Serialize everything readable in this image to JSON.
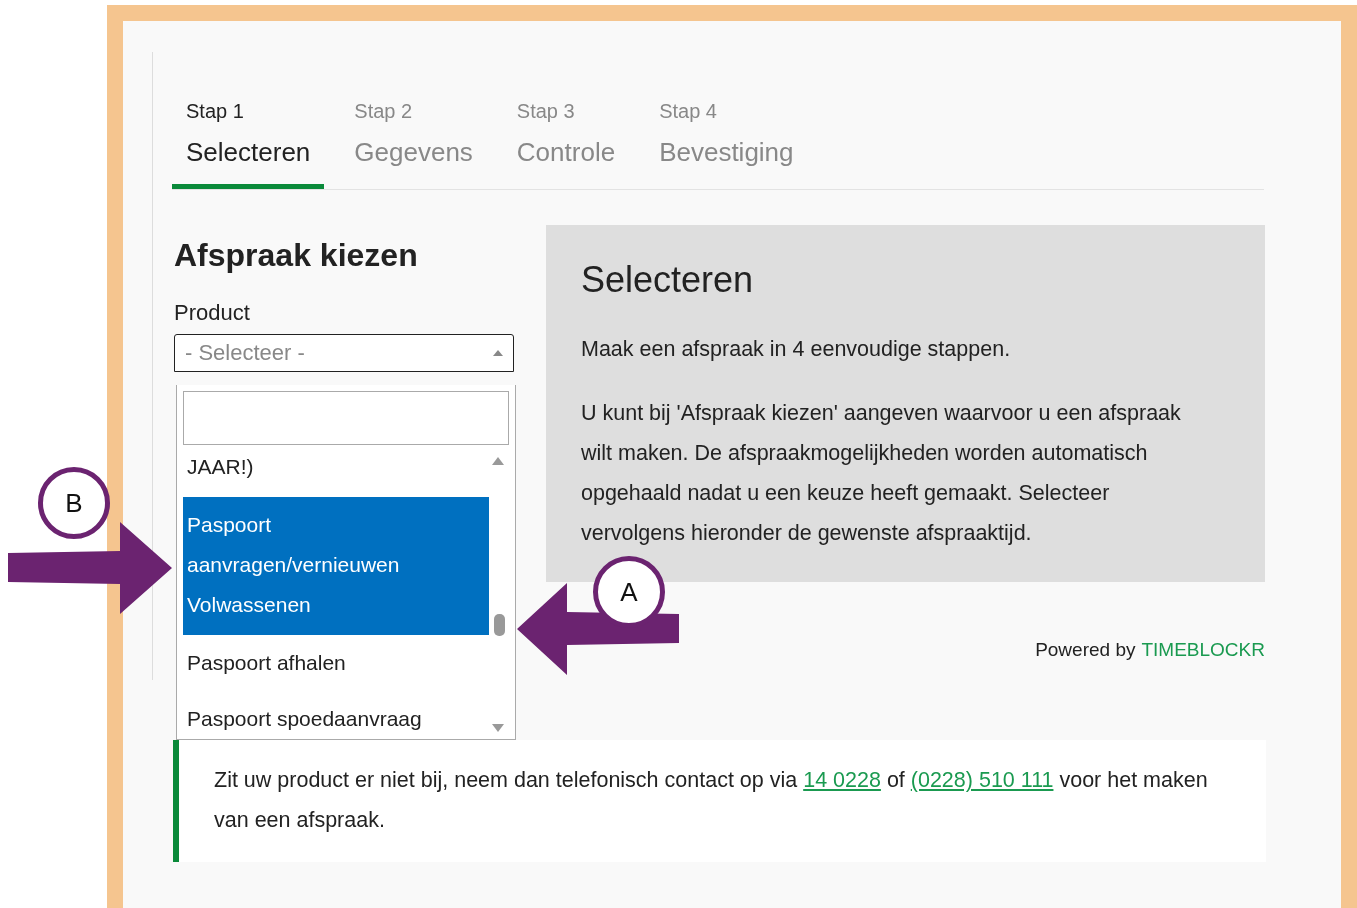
{
  "steps": [
    {
      "step": "Stap 1",
      "label": "Selecteren",
      "selected": true
    },
    {
      "step": "Stap 2",
      "label": "Gegevens",
      "selected": false
    },
    {
      "step": "Stap 3",
      "label": "Controle",
      "selected": false
    },
    {
      "step": "Stap 4",
      "label": "Bevestiging",
      "selected": false
    }
  ],
  "form": {
    "heading": "Afspraak kiezen",
    "product_label": "Product",
    "select_placeholder": "- Selecteer -",
    "expanded": true,
    "options": [
      {
        "label": "JAAR!)",
        "selected": false
      },
      {
        "label": "Paspoort aanvragen/vernieuwen Volwassenen",
        "selected": true
      },
      {
        "label": "Paspoort afhalen",
        "selected": false
      },
      {
        "label": "Paspoort spoedaanvraag",
        "selected": false
      }
    ]
  },
  "info_panel": {
    "title": "Selecteren",
    "paragraphs": [
      "Maak een afspraak in 4 eenvoudige stappen.",
      "U kunt bij 'Afspraak kiezen' aangeven waarvoor u een afspraak wilt maken. De afspraakmogelijkheden worden automatisch opgehaald nadat u een keuze heeft gemaakt. Selecteer vervolgens hieronder de gewenste afspraaktijd."
    ]
  },
  "powered_by": {
    "text": "Powered by",
    "brand": "TIMEBLOCKR"
  },
  "notice": {
    "parts": [
      {
        "kind": "text",
        "text": "Zit uw product er niet bij, neem dan telefonisch contact op via "
      },
      {
        "kind": "link",
        "text": "14 0228"
      },
      {
        "kind": "text",
        "text": " of "
      },
      {
        "kind": "link",
        "text": "(0228) 510 111"
      },
      {
        "kind": "text",
        "text": " voor het maken van een afspraak."
      }
    ]
  },
  "annotations": [
    {
      "label": "B"
    },
    {
      "label": "A"
    }
  ]
}
